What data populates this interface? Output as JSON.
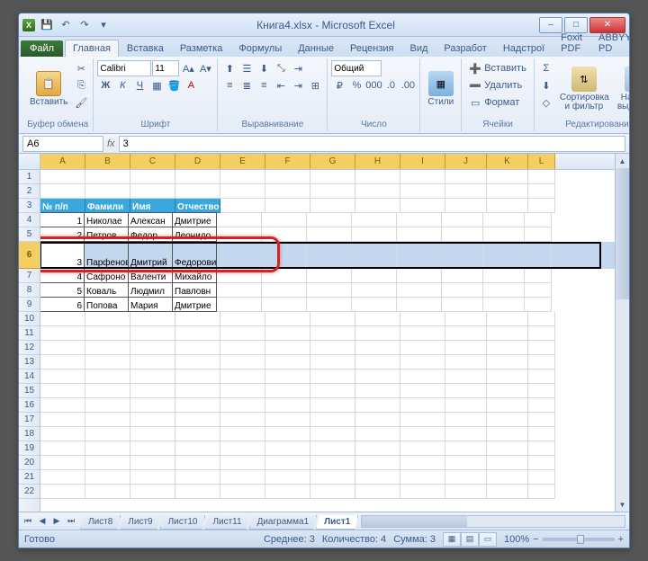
{
  "titlebar": {
    "title": "Книга4.xlsx - Microsoft Excel"
  },
  "win": {
    "min": "–",
    "max": "□",
    "close": "✕"
  },
  "tabs": {
    "file": "Файл",
    "home": "Главная",
    "insert": "Вставка",
    "layout": "Разметка",
    "formulas": "Формулы",
    "data": "Данные",
    "review": "Рецензия",
    "view": "Вид",
    "dev": "Разработ",
    "addins": "Надстрої",
    "foxit": "Foxit PDF",
    "abbyy": "ABBYY PD"
  },
  "ribbon": {
    "paste": "Вставить",
    "clipboard": "Буфер обмена",
    "font": "Шрифт",
    "align": "Выравнивание",
    "number": "Число",
    "styles": "Стили",
    "cells": "Ячейки",
    "editing": "Редактирование",
    "fontname": "Calibri",
    "fontsize": "11",
    "numfmt": "Общий",
    "insert": "Вставить",
    "delete": "Удалить",
    "format": "Формат",
    "sort": "Сортировка и фильтр",
    "find": "Найти и выделить"
  },
  "namebox": "A6",
  "formula": "3",
  "cols": [
    "A",
    "B",
    "C",
    "D",
    "E",
    "F",
    "G",
    "H",
    "I",
    "J",
    "K",
    "L"
  ],
  "rows": [
    1,
    2,
    3,
    4,
    5,
    6,
    7,
    8,
    9,
    10,
    11,
    12,
    13,
    14,
    15,
    16,
    17,
    18,
    19,
    20,
    21,
    22
  ],
  "table": {
    "headers": {
      "n": "№ п/п",
      "fam": "Фамили",
      "name": "Имя",
      "otch": "Отчество"
    },
    "data": [
      {
        "n": "1",
        "fam": "Николае",
        "name": "Алексан",
        "otch": "Дмитрие"
      },
      {
        "n": "2",
        "fam": "Петров",
        "name": "Федор",
        "otch": "Леонидо"
      },
      {
        "n": "3",
        "fam": "Парфенов",
        "name": "Дмитрий",
        "otch": "Федорович"
      },
      {
        "n": "4",
        "fam": "Сафроно",
        "name": "Валенти",
        "otch": "Михайло"
      },
      {
        "n": "5",
        "fam": "Коваль",
        "name": "Людмил",
        "otch": "Павловн"
      },
      {
        "n": "6",
        "fam": "Попова",
        "name": "Мария",
        "otch": "Дмитрие"
      }
    ]
  },
  "sheets": {
    "t1": "Лист8",
    "t2": "Лист9",
    "t3": "Лист10",
    "t4": "Лист11",
    "t5": "Диаграмма1",
    "active": "Лист1"
  },
  "status": {
    "ready": "Готово",
    "avg": "Среднее: 3",
    "count": "Количество: 4",
    "sum": "Сумма: 3",
    "zoom": "100%"
  }
}
